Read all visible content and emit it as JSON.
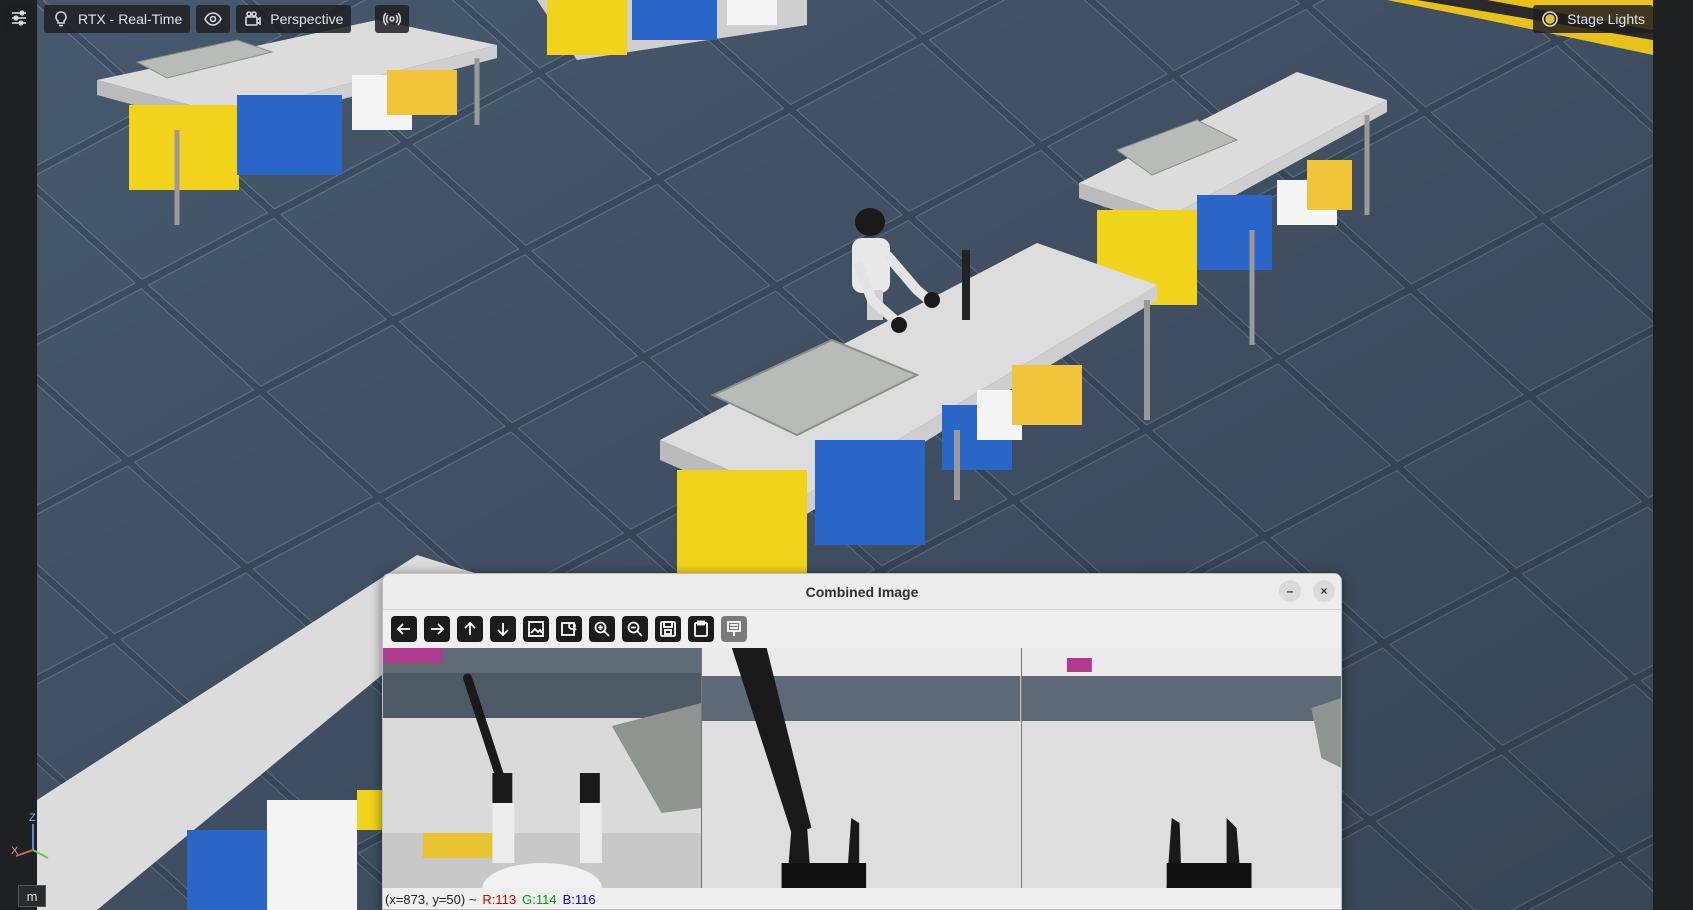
{
  "viewport": {
    "renderer_label": "RTX - Real-Time",
    "camera_label": "Perspective",
    "stage_lights_label": "Stage Lights",
    "unit_label": "m",
    "axis_labels": {
      "z": "Z",
      "x": "X"
    },
    "icons": [
      "settings-icon",
      "lightbulb-icon",
      "eye-icon",
      "camera-icon",
      "broadcast-icon",
      "sun-icon"
    ]
  },
  "window": {
    "title": "Combined Image",
    "minimize_label": "–",
    "close_label": "×",
    "toolbar_icons": [
      "arrow-left-icon",
      "arrow-right-icon",
      "arrow-up-icon",
      "arrow-down-icon",
      "image-icon",
      "image-search-icon",
      "zoom-in-icon",
      "zoom-out-icon",
      "save-icon",
      "clipboard-icon",
      "properties-icon"
    ],
    "status": {
      "coords": "(x=873, y=50) ~",
      "r": "R:113",
      "g": "G:114",
      "b": "B:116"
    }
  },
  "colors": {
    "floor": "#425466",
    "table_top": "#dcdcdc",
    "crate_yellow": "#f2d31b",
    "crate_blue": "#2a66c8",
    "status_red": "#cc0000",
    "status_green": "#00a000",
    "status_blue": "#0000cc"
  }
}
